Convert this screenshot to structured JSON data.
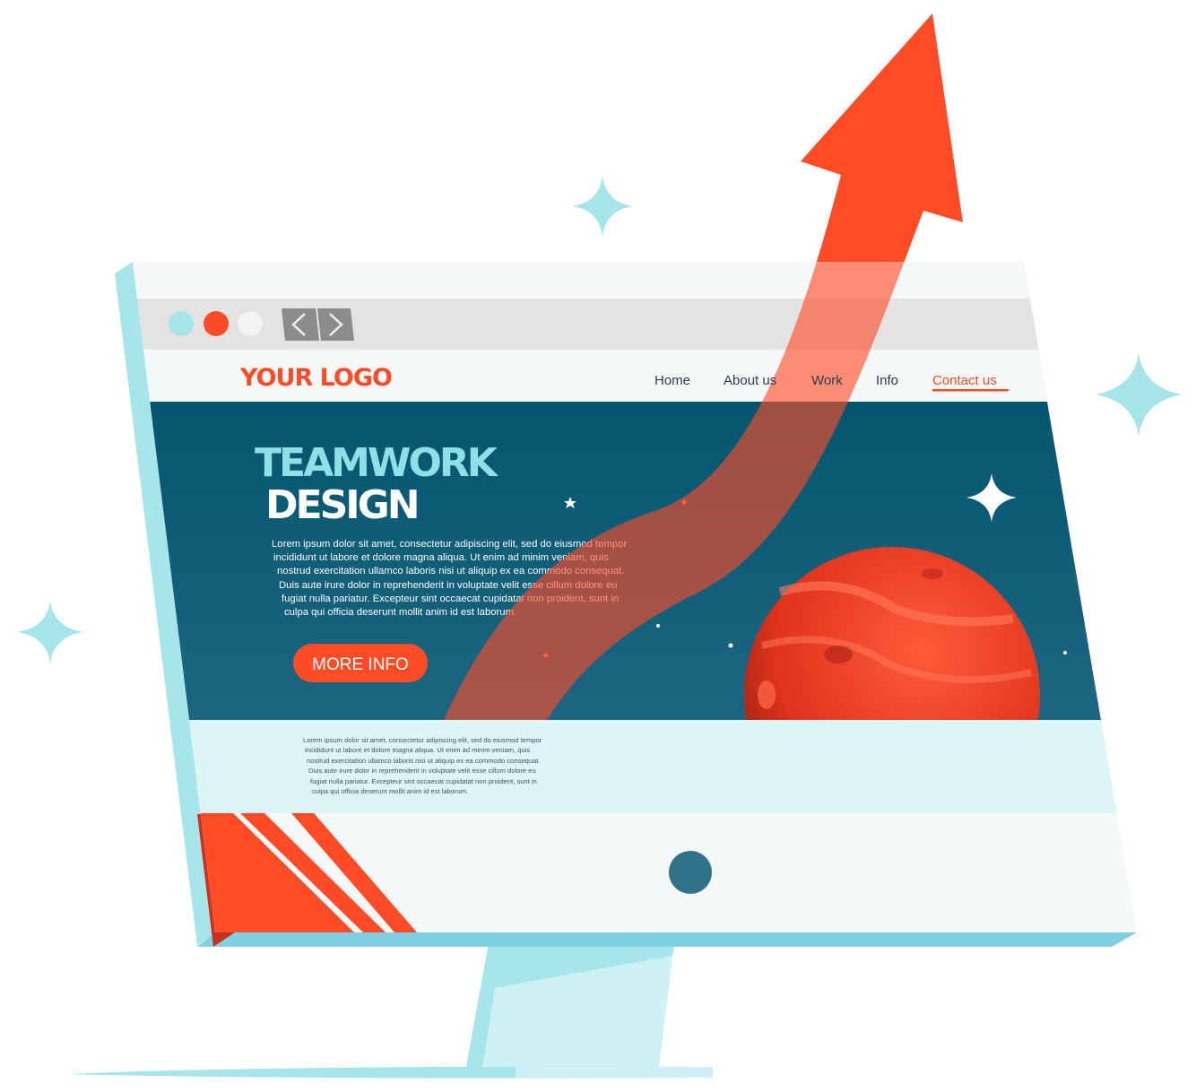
{
  "browser": {
    "window_dots": [
      "#a6e5ea",
      "#ff4b26",
      "#f3f3f3"
    ],
    "back_icon": "chevron-left-icon",
    "forward_icon": "chevron-right-icon"
  },
  "header": {
    "logo": "YOUR LOGO",
    "nav": [
      {
        "label": "Home",
        "active": false
      },
      {
        "label": "About us",
        "active": false
      },
      {
        "label": "Work",
        "active": false
      },
      {
        "label": "Info",
        "active": false
      },
      {
        "label": "Contact us",
        "active": true
      }
    ]
  },
  "hero": {
    "title_line1": "TEAMWORK",
    "title_line2": "DESIGN",
    "paragraph_lines": [
      "Lorem ipsum dolor sit amet, consectetur adipiscing elit, sed do eiusmod tempor",
      "incididunt ut labore et dolore magna aliqua. Ut enim ad minim veniam, quis",
      "nostrud exercitation ullamco laboris nisi ut aliquip ex ea commodo consequat.",
      "Duis aute irure dolor in reprehenderit in voluptate velit esse cillum dolore eu",
      "fugiat nulla pariatur. Excepteur sint occaecat cupidatat non proident, sunt in",
      "culpa qui officia deserunt mollit anim id est laborum."
    ],
    "button_label": "MORE INFO"
  },
  "section": {
    "paragraph_lines": [
      "Lorem ipsum dolor sit amet, consectetur adipiscing elit, sed do eiusmod tempor",
      "incididunt ut labore et dolore magna aliqua. Ut enim ad minim veniam, quis",
      "nostrud exercitation ullamco laboris nisi ut aliquip ex ea commodo consequat.",
      "Duis aute irure dolor in reprehenderit in voluptate velit esse cillum dolore eu",
      "fugiat nulla pariatur. Excepteur sint occaecat cupidatat non proident, sunt in",
      "culpa qui officia deserunt mollit anim id est laborum."
    ]
  },
  "colors": {
    "accent": "#ff4b26",
    "hero_bg": "#0d5a78",
    "screen_edge": "#a6e5ea",
    "light_section": "#def5f7",
    "sparkle": "#a6e5ea"
  }
}
